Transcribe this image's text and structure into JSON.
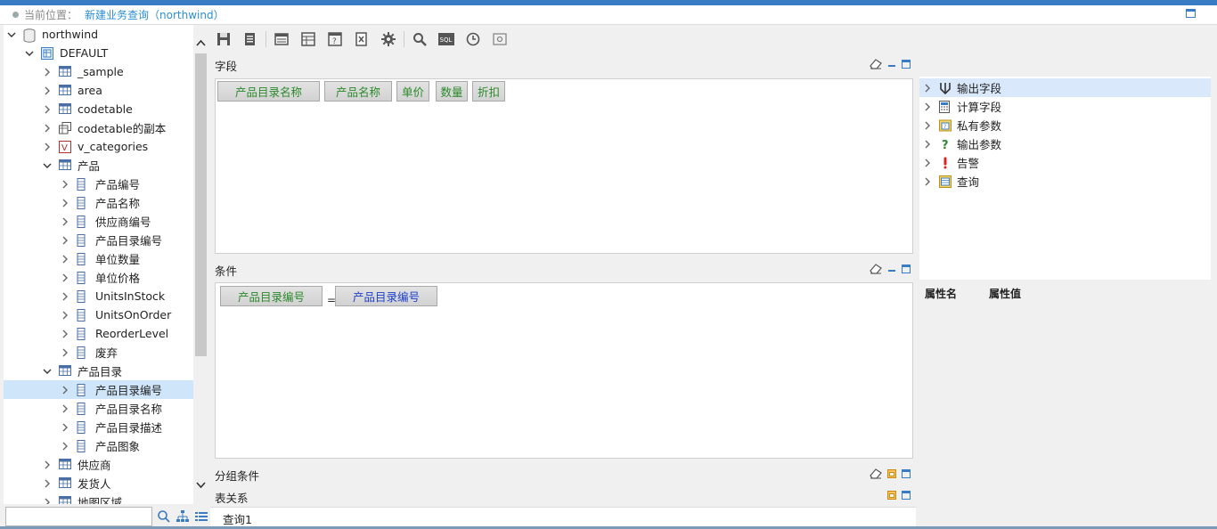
{
  "breadcrumb": {
    "label": "当前位置：",
    "current": "新建业务查询（northwind）"
  },
  "tree": {
    "items": [
      {
        "label": "northwind",
        "level": 0,
        "expanded": true,
        "icon": "database-icon"
      },
      {
        "label": "DEFAULT",
        "level": 1,
        "expanded": true,
        "icon": "schema-icon"
      },
      {
        "label": "_sample",
        "level": 2,
        "expanded": false,
        "icon": "table-icon"
      },
      {
        "label": "area",
        "level": 2,
        "expanded": false,
        "icon": "table-icon"
      },
      {
        "label": "codetable",
        "level": 2,
        "expanded": false,
        "icon": "table-icon"
      },
      {
        "label": "codetable的副本",
        "level": 2,
        "expanded": false,
        "icon": "table-copy-icon"
      },
      {
        "label": "v_categories",
        "level": 2,
        "expanded": false,
        "icon": "view-icon"
      },
      {
        "label": "产品",
        "level": 2,
        "expanded": true,
        "icon": "table-icon"
      },
      {
        "label": "产品编号",
        "level": 3,
        "expanded": false,
        "icon": "field-icon"
      },
      {
        "label": "产品名称",
        "level": 3,
        "expanded": false,
        "icon": "field-icon"
      },
      {
        "label": "供应商编号",
        "level": 3,
        "expanded": false,
        "icon": "field-icon"
      },
      {
        "label": "产品目录编号",
        "level": 3,
        "expanded": false,
        "icon": "field-icon"
      },
      {
        "label": "单位数量",
        "level": 3,
        "expanded": false,
        "icon": "field-icon"
      },
      {
        "label": "单位价格",
        "level": 3,
        "expanded": false,
        "icon": "field-icon"
      },
      {
        "label": "UnitsInStock",
        "level": 3,
        "expanded": false,
        "icon": "field-icon"
      },
      {
        "label": "UnitsOnOrder",
        "level": 3,
        "expanded": false,
        "icon": "field-icon"
      },
      {
        "label": "ReorderLevel",
        "level": 3,
        "expanded": false,
        "icon": "field-icon"
      },
      {
        "label": "废弃",
        "level": 3,
        "expanded": false,
        "icon": "field-icon"
      },
      {
        "label": "产品目录",
        "level": 2,
        "expanded": true,
        "icon": "table-icon"
      },
      {
        "label": "产品目录编号",
        "level": 3,
        "expanded": false,
        "icon": "field-icon",
        "selected": true
      },
      {
        "label": "产品目录名称",
        "level": 3,
        "expanded": false,
        "icon": "field-icon"
      },
      {
        "label": "产品目录描述",
        "level": 3,
        "expanded": false,
        "icon": "field-icon"
      },
      {
        "label": "产品图象",
        "level": 3,
        "expanded": false,
        "icon": "field-icon"
      },
      {
        "label": "供应商",
        "level": 2,
        "expanded": false,
        "icon": "table-icon"
      },
      {
        "label": "发货人",
        "level": 2,
        "expanded": false,
        "icon": "table-icon"
      },
      {
        "label": "地图区域",
        "level": 2,
        "expanded": false,
        "icon": "table-icon"
      }
    ],
    "search_placeholder": ""
  },
  "toolbar": {
    "buttons": [
      "save-icon",
      "save-as-icon",
      "layout-icon",
      "table-layout-icon",
      "help-form-icon",
      "export-icon",
      "settings-icon",
      "search-icon",
      "sql-icon",
      "clock-icon",
      "preview-icon"
    ]
  },
  "sections": {
    "fields": {
      "title": "字段",
      "chips": [
        "产品目录名称",
        "产品名称",
        "单价",
        "数量",
        "折扣"
      ]
    },
    "conditions": {
      "title": "条件",
      "left": "产品目录编号",
      "operator": "=",
      "right": "产品目录编号"
    },
    "group": {
      "title": "分组条件"
    },
    "relations": {
      "title": "表关系"
    }
  },
  "right_panel": {
    "items": [
      {
        "label": "输出字段",
        "icon": "output-field-icon",
        "selected": true
      },
      {
        "label": "计算字段",
        "icon": "calc-field-icon"
      },
      {
        "label": "私有参数",
        "icon": "private-param-icon"
      },
      {
        "label": "输出参数",
        "icon": "output-param-icon"
      },
      {
        "label": "告警",
        "icon": "alert-icon"
      },
      {
        "label": "查询",
        "icon": "query-icon"
      }
    ],
    "prop_name_header": "属性名",
    "prop_value_header": "属性值"
  },
  "tabs": {
    "query": "查询1"
  },
  "colors": {
    "accent": "#3a7cc4",
    "link": "#2b8fd6",
    "field_text": "#2a8a2a",
    "cond_right_text": "#1a3fcf",
    "selected": "#cfe5fa"
  }
}
